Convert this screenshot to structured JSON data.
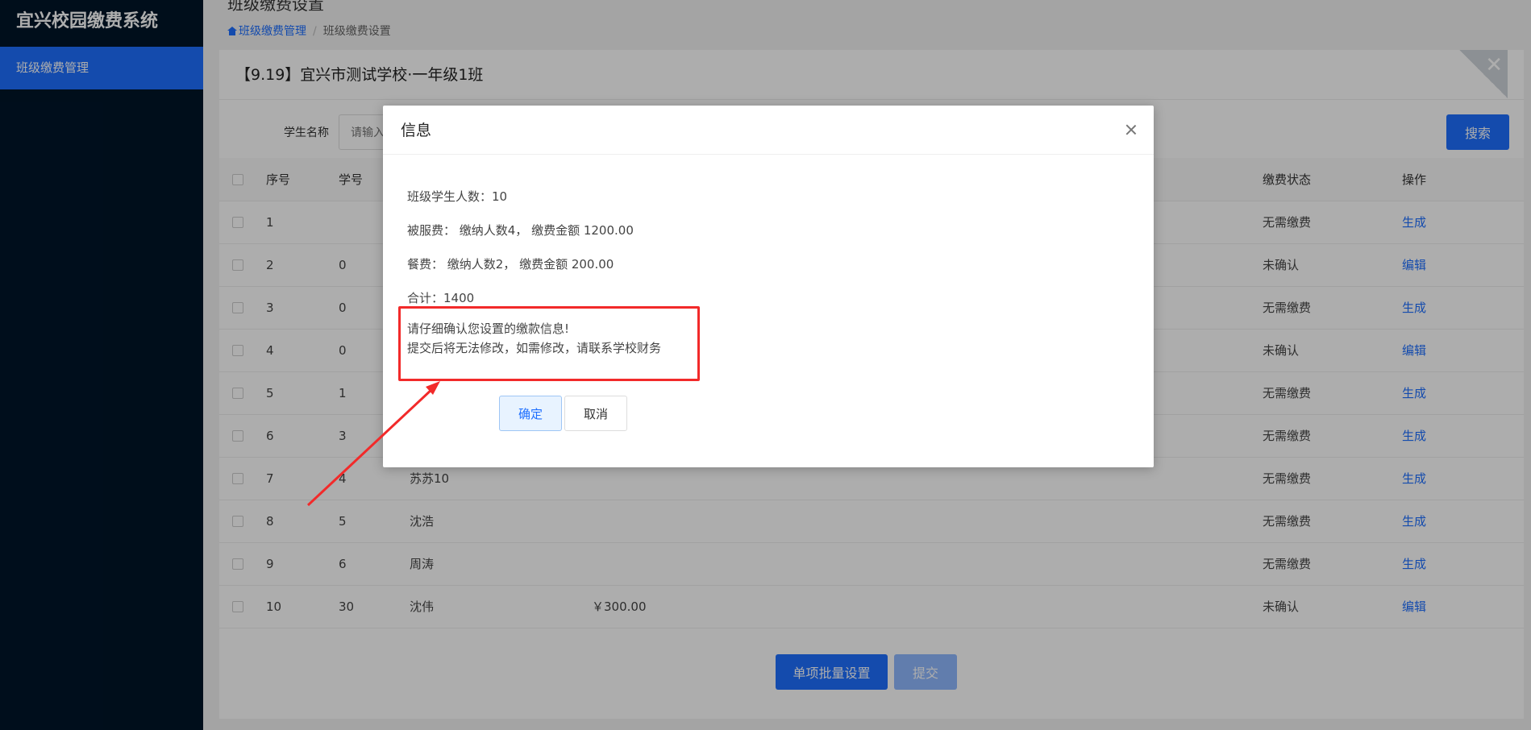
{
  "app": {
    "brand": "宜兴校园缴费系统"
  },
  "sidebar": {
    "items": [
      {
        "label": "班级缴费管理"
      }
    ]
  },
  "header": {
    "title": "班级缴费设置",
    "breadcrumb": {
      "home": "班级缴费管理",
      "current": "班级缴费设置"
    }
  },
  "card": {
    "title": "【9.19】宜兴市测试学校·一年级1班"
  },
  "search": {
    "label": "学生名称",
    "placeholder": "请输入",
    "button": "搜索"
  },
  "table": {
    "columns": {
      "no": "序号",
      "sid": "学号",
      "status": "缴费状态",
      "op": "操作"
    },
    "rows": [
      {
        "no": "1",
        "sid": "",
        "name": "",
        "amount": "",
        "status": "无需缴费",
        "op": "生成"
      },
      {
        "no": "2",
        "sid": "0",
        "name": "",
        "amount": "",
        "status": "未确认",
        "op": "编辑"
      },
      {
        "no": "3",
        "sid": "0",
        "name": "",
        "amount": "",
        "status": "无需缴费",
        "op": "生成"
      },
      {
        "no": "4",
        "sid": "0",
        "name": "",
        "amount": "",
        "status": "未确认",
        "op": "编辑"
      },
      {
        "no": "5",
        "sid": "1",
        "name": "",
        "amount": "",
        "status": "无需缴费",
        "op": "生成"
      },
      {
        "no": "6",
        "sid": "3",
        "name": "",
        "amount": "",
        "status": "无需缴费",
        "op": "生成"
      },
      {
        "no": "7",
        "sid": "4",
        "name": "苏苏10",
        "amount": "",
        "status": "无需缴费",
        "op": "生成"
      },
      {
        "no": "8",
        "sid": "5",
        "name": "沈浩",
        "amount": "",
        "status": "无需缴费",
        "op": "生成"
      },
      {
        "no": "9",
        "sid": "6",
        "name": "周涛",
        "amount": "",
        "status": "无需缴费",
        "op": "生成"
      },
      {
        "no": "10",
        "sid": "30",
        "name": "沈伟",
        "amount": "￥300.00",
        "status": "未确认",
        "op": "编辑"
      }
    ]
  },
  "footer": {
    "batch_button": "单项批量设置",
    "submit_button": "提交"
  },
  "dialog": {
    "title": "信息",
    "lines": [
      "班级学生人数：10",
      "被服费： 缴纳人数4， 缴费金额 1200.00",
      "餐费： 缴纳人数2， 缴费金额 200.00",
      "合计：1400"
    ],
    "warning_line1": "请仔细确认您设置的缴款信息!",
    "warning_line2": "提交后将无法修改，如需修改，请联系学校财务",
    "ok": "确定",
    "cancel": "取消"
  },
  "colors": {
    "primary": "#1e6fff",
    "sidebar_bg": "#001529",
    "pending_status": "#f0a020",
    "annotation": "#f22a2a"
  }
}
